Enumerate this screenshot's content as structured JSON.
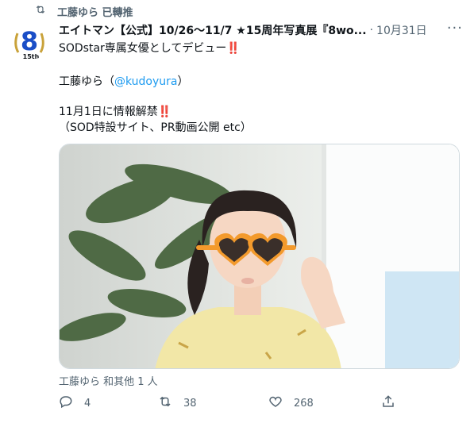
{
  "retweet": {
    "label": "工藤ゆら 已轉推"
  },
  "tweet": {
    "author_name": "エイトマン【公式】10/26〜11/7 ★15周年写真展『8wo...",
    "separator": "·",
    "date": "10月31日",
    "line1": "SODstar専属女優としてデビュー",
    "line2_name": "工藤ゆら（",
    "line2_mention": "@kudoyura",
    "line2_close": "）",
    "line3": "11月1日に情報解禁",
    "line4": "（SOD特設サイト、PR動画公開 etc）",
    "bang": "‼️",
    "avatar_text": "8",
    "avatar_sub": "15th"
  },
  "media": {
    "tagged": "工藤ゆら 和其他 1 人"
  },
  "actions": {
    "reply_count": "4",
    "retweet_count": "38",
    "like_count": "268"
  },
  "colors": {
    "accent": "#1d9bf0",
    "muted": "#536471",
    "avatar_blue": "#1a4ec7",
    "laurel": "#c9a23a"
  }
}
